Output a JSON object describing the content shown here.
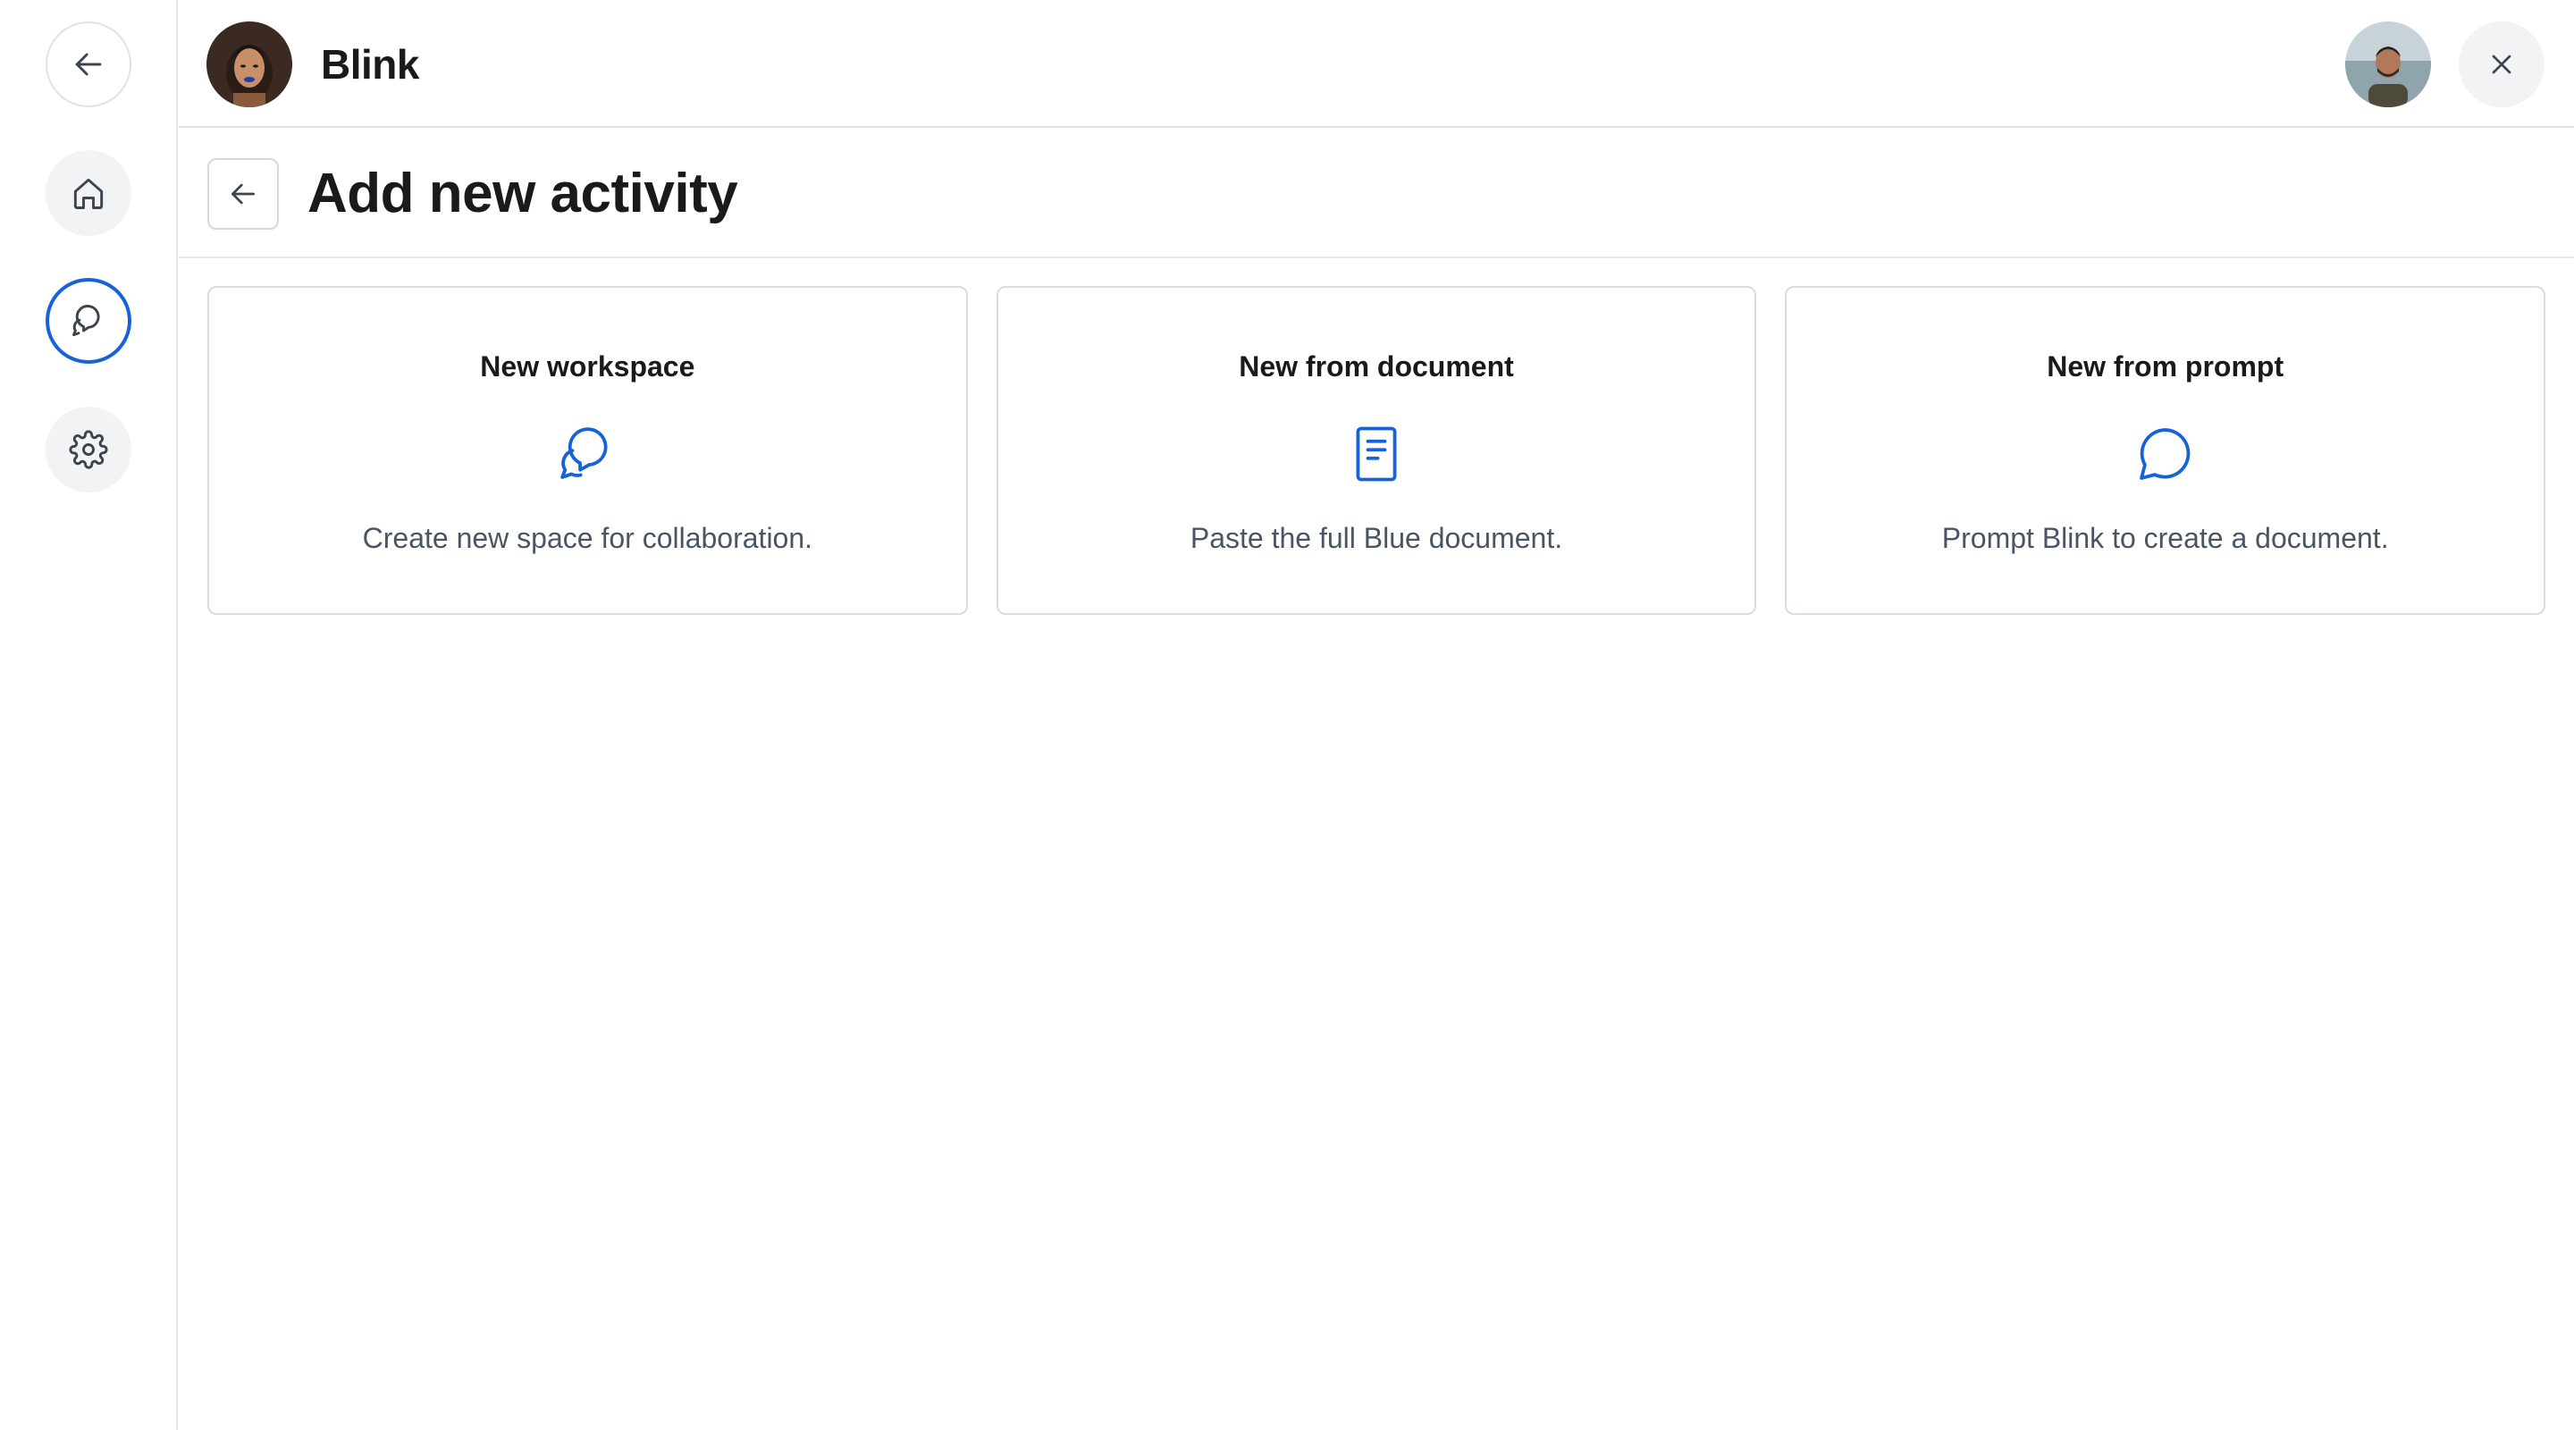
{
  "header": {
    "brand_name": "Blink",
    "brand_avatar_icon": "brand-avatar-photo",
    "user_avatar_icon": "user-avatar-photo",
    "close_icon": "close-icon"
  },
  "rail": {
    "items": [
      {
        "name": "back",
        "icon": "arrow-left-icon",
        "active": false
      },
      {
        "name": "home",
        "icon": "home-icon",
        "active": false
      },
      {
        "name": "chat",
        "icon": "chat-bubbles-icon",
        "active": true
      },
      {
        "name": "settings",
        "icon": "gear-icon",
        "active": false
      }
    ]
  },
  "page": {
    "title": "Add new activity",
    "back_icon": "arrow-left-icon"
  },
  "cards": [
    {
      "title": "New workspace",
      "description": "Create new space for collaboration.",
      "icon": "chat-bubbles-icon"
    },
    {
      "title": "New from document",
      "description": "Paste the full Blue document.",
      "icon": "document-icon"
    },
    {
      "title": "New from prompt",
      "description": "Prompt Blink to create a document.",
      "icon": "speech-bubble-icon"
    }
  ],
  "colors": {
    "accent": "#1662d6",
    "border": "#d9dce1",
    "muted_text": "#4a5563",
    "rail_button_bg": "#f2f3f5"
  }
}
